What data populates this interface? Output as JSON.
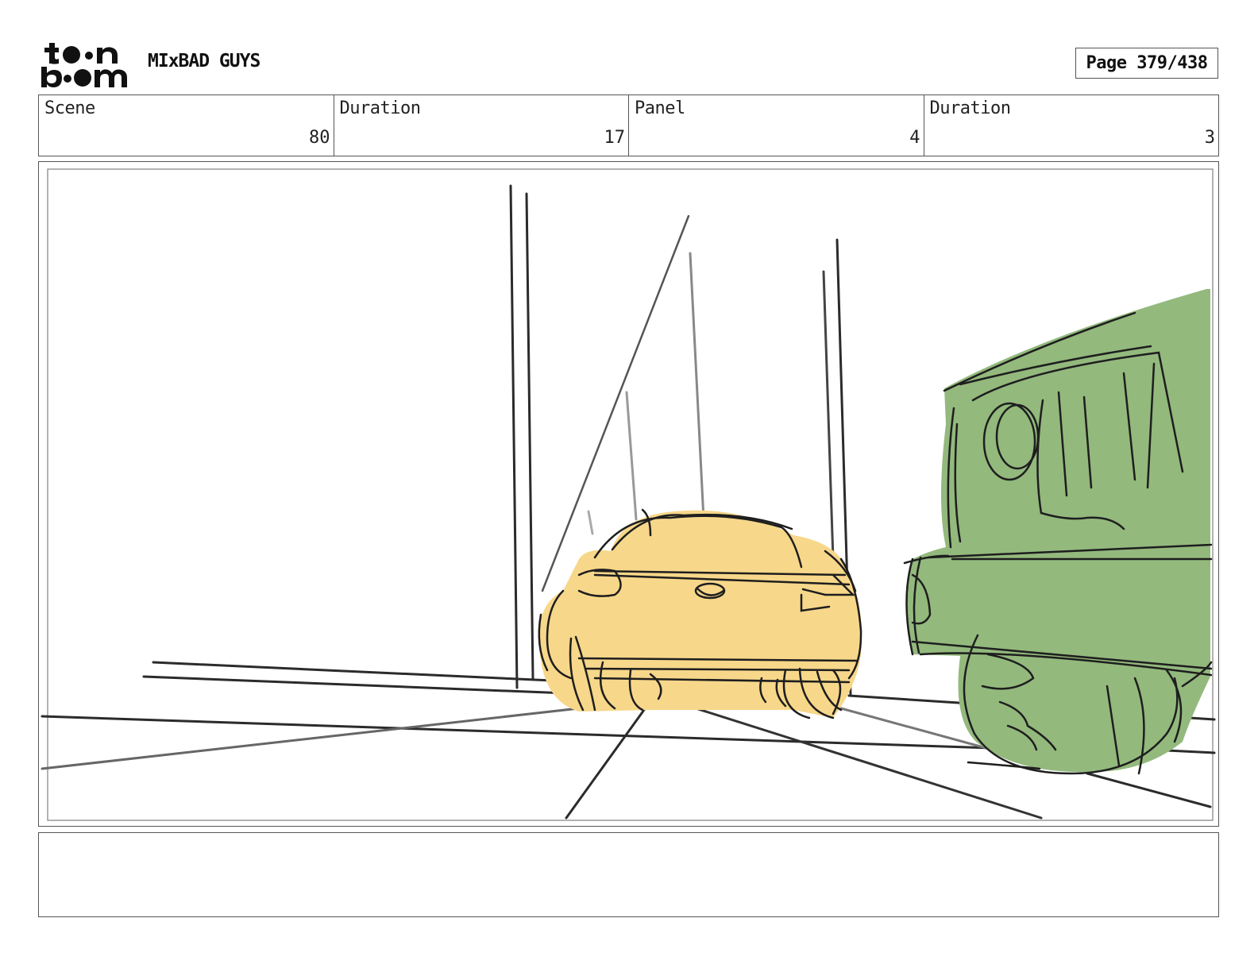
{
  "header": {
    "logo_text": "toon boom",
    "project_title": "MIxBAD GUYS",
    "page_label": "Page 379/438"
  },
  "info": {
    "scene_label": "Scene",
    "scene_value": "80",
    "scene_duration_label": "Duration",
    "scene_duration_value": "17",
    "panel_label": "Panel",
    "panel_value": "4",
    "panel_duration_label": "Duration",
    "panel_duration_value": "3"
  },
  "panel_art": {
    "car_color": "#f7d78a",
    "truck_color": "#93b97d",
    "line_color": "#2b2b2b"
  },
  "notes": {
    "text": ""
  }
}
